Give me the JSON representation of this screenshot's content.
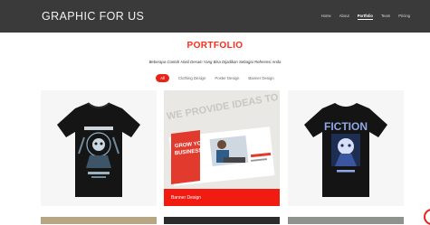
{
  "brand": {
    "name": "GRAPHIC FOR US"
  },
  "nav": {
    "items": [
      {
        "label": "Home",
        "active": false
      },
      {
        "label": "About",
        "active": false
      },
      {
        "label": "Portfolio",
        "active": true
      },
      {
        "label": "Team",
        "active": false
      },
      {
        "label": "Pricing",
        "active": false
      }
    ]
  },
  "portfolio": {
    "title": "PORTFOLIO",
    "subtitle": "Beberapa Contoh Hasil Desain Yang Bisa Dijadikan Sebagai Referensi Anda",
    "filters": [
      {
        "label": "All",
        "active": true
      },
      {
        "label": "Clothing Design",
        "active": false
      },
      {
        "label": "Poster Design",
        "active": false
      },
      {
        "label": "Banner Design",
        "active": false
      }
    ],
    "cards": [
      {
        "image": "black-tshirt-graphic"
      },
      {
        "image": "business-banner",
        "caption": "Banner Design"
      },
      {
        "image": "fiction-tshirt",
        "shirt_text": "FICTION"
      }
    ],
    "banner_image_text": {
      "headline": "GROW YOUR BUSINESS!",
      "tagline": "WE PROVIDE IDEAS TO GROW YOUR"
    }
  },
  "colors": {
    "accent": "#e8231a",
    "navbar": "#3a3a3a"
  }
}
